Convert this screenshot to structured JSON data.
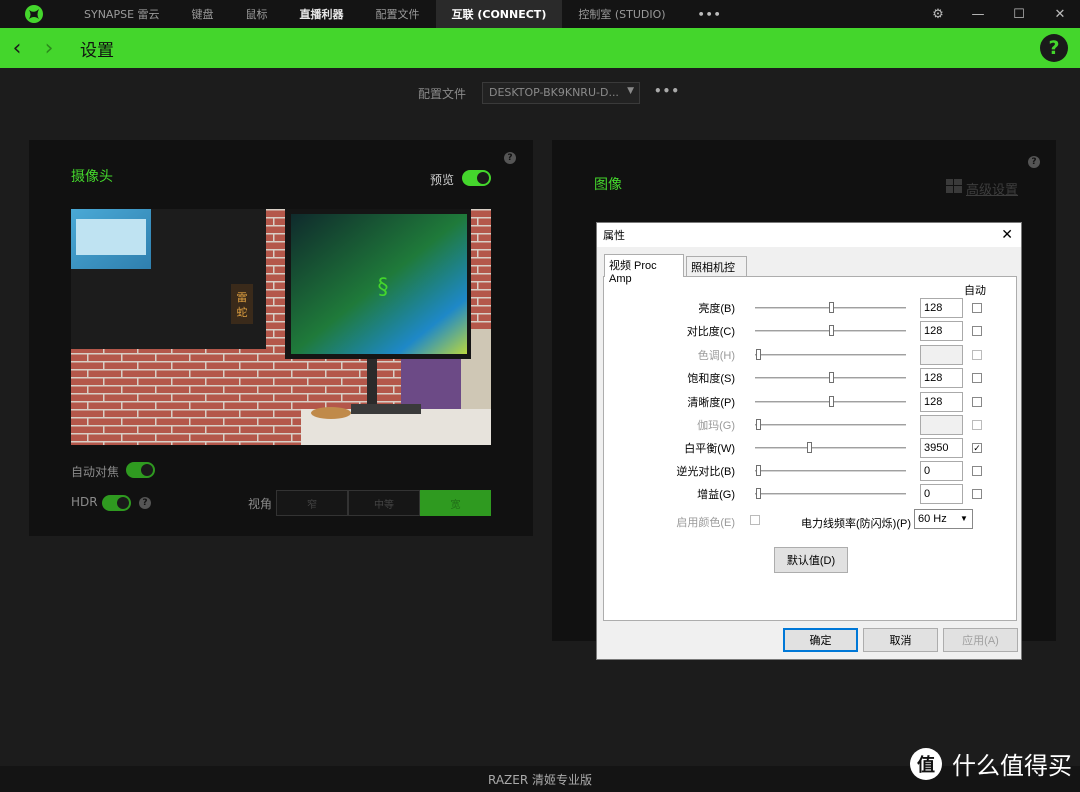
{
  "tabs": [
    {
      "label": "SYNAPSE 雷云"
    },
    {
      "label": "键盘"
    },
    {
      "label": "鼠标"
    },
    {
      "label": "直播利器"
    },
    {
      "label": "配置文件"
    },
    {
      "label": "互联 (CONNECT)"
    },
    {
      "label": "控制室 (STUDIO)"
    }
  ],
  "tabs_more": "•••",
  "window_controls": {
    "settings": "⚙",
    "minimize": "—",
    "maximize": "☐",
    "close": "✕"
  },
  "header": {
    "back": "‹",
    "forward": "›",
    "title": "设置",
    "help": "?"
  },
  "profile": {
    "label": "配置文件",
    "value": "DESKTOP-BK9KNRU-D...",
    "more": "•••"
  },
  "camera_panel": {
    "title": "摄像头",
    "preview_label": "预览",
    "autofocus_label": "自动对焦",
    "hdr_label": "HDR",
    "view_label": "视角",
    "help": "?",
    "view_options": [
      "窄",
      "中等",
      "宽"
    ],
    "image_sign": "雷蛇"
  },
  "image_panel": {
    "title": "图像",
    "advanced": "高级设置",
    "help": "?"
  },
  "dialog": {
    "title": "属性",
    "close": "✕",
    "tabs": [
      "视频 Proc Amp",
      "照相机控制"
    ],
    "auto_header": "自动",
    "rows": [
      {
        "label": "亮度(B)",
        "value": "128",
        "pos": 0.5,
        "enabled": true,
        "auto": false
      },
      {
        "label": "对比度(C)",
        "value": "128",
        "pos": 0.5,
        "enabled": true,
        "auto": false
      },
      {
        "label": "色调(H)",
        "value": "",
        "pos": 0.02,
        "enabled": false,
        "auto": false
      },
      {
        "label": "饱和度(S)",
        "value": "128",
        "pos": 0.5,
        "enabled": true,
        "auto": false
      },
      {
        "label": "清晰度(P)",
        "value": "128",
        "pos": 0.5,
        "enabled": true,
        "auto": false
      },
      {
        "label": "伽玛(G)",
        "value": "",
        "pos": 0.02,
        "enabled": false,
        "auto": false
      },
      {
        "label": "白平衡(W)",
        "value": "3950",
        "pos": 0.36,
        "enabled": true,
        "auto": true
      },
      {
        "label": "逆光对比(B)",
        "value": "0",
        "pos": 0.02,
        "enabled": true,
        "auto": false
      },
      {
        "label": "增益(G)",
        "value": "0",
        "pos": 0.02,
        "enabled": true,
        "auto": false
      }
    ],
    "color_enable_label": "启用颜色(E)",
    "powerline_label": "电力线频率(防闪烁)(P)",
    "powerline_value": "60 Hz",
    "default_button": "默认值(D)",
    "ok_button": "确定",
    "cancel_button": "取消",
    "apply_button": "应用(A)"
  },
  "footer": "RAZER 清姬专业版",
  "watermark": {
    "icon": "值",
    "text": "什么值得买"
  }
}
